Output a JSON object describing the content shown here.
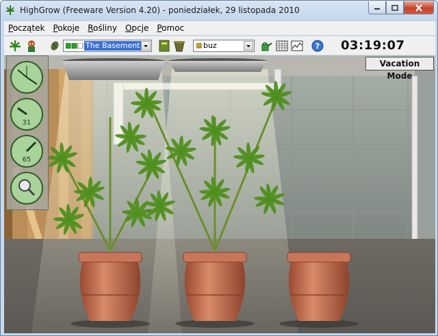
{
  "window": {
    "title": "HighGrow (Freeware Version 4.20) - poniedziałek, 29 listopada 2010",
    "controls": [
      "minimize",
      "maximize",
      "close"
    ]
  },
  "menu": [
    {
      "label": "Początek",
      "accel": "P",
      "rest": "oczątek"
    },
    {
      "label": "Pokoje",
      "accel": "P",
      "rest": "okoje"
    },
    {
      "label": "Rośliny",
      "accel": "R",
      "rest": "ośliny"
    },
    {
      "label": "Opcje",
      "accel": "O",
      "rest": "pcje"
    },
    {
      "label": "Pomoc",
      "accel": "P",
      "rest": "omoc"
    }
  ],
  "toolbar": {
    "room_select": {
      "value": "The Basement"
    },
    "plant_select": {
      "value": "buz"
    },
    "clock": "03:19:07",
    "icons": [
      "leaf-icon",
      "grower-icon",
      "seed-icon",
      "book-icon",
      "pot-icon",
      "watering-can-icon",
      "grid-icon",
      "chart-icon",
      "help-icon"
    ]
  },
  "scene": {
    "vacation_button": "Vacation Mode",
    "dials": [
      {
        "name": "clock-dial",
        "value": ""
      },
      {
        "name": "moisture-dial",
        "value": "31"
      },
      {
        "name": "light-dial",
        "value": "65"
      }
    ],
    "magnifier": "magnifier-icon",
    "plants": 3
  },
  "colors": {
    "title_bar": "#c6d9ee",
    "dial_green": "#a9d39a",
    "pot": "#c8765a",
    "leaf": "#4f8f1e"
  }
}
